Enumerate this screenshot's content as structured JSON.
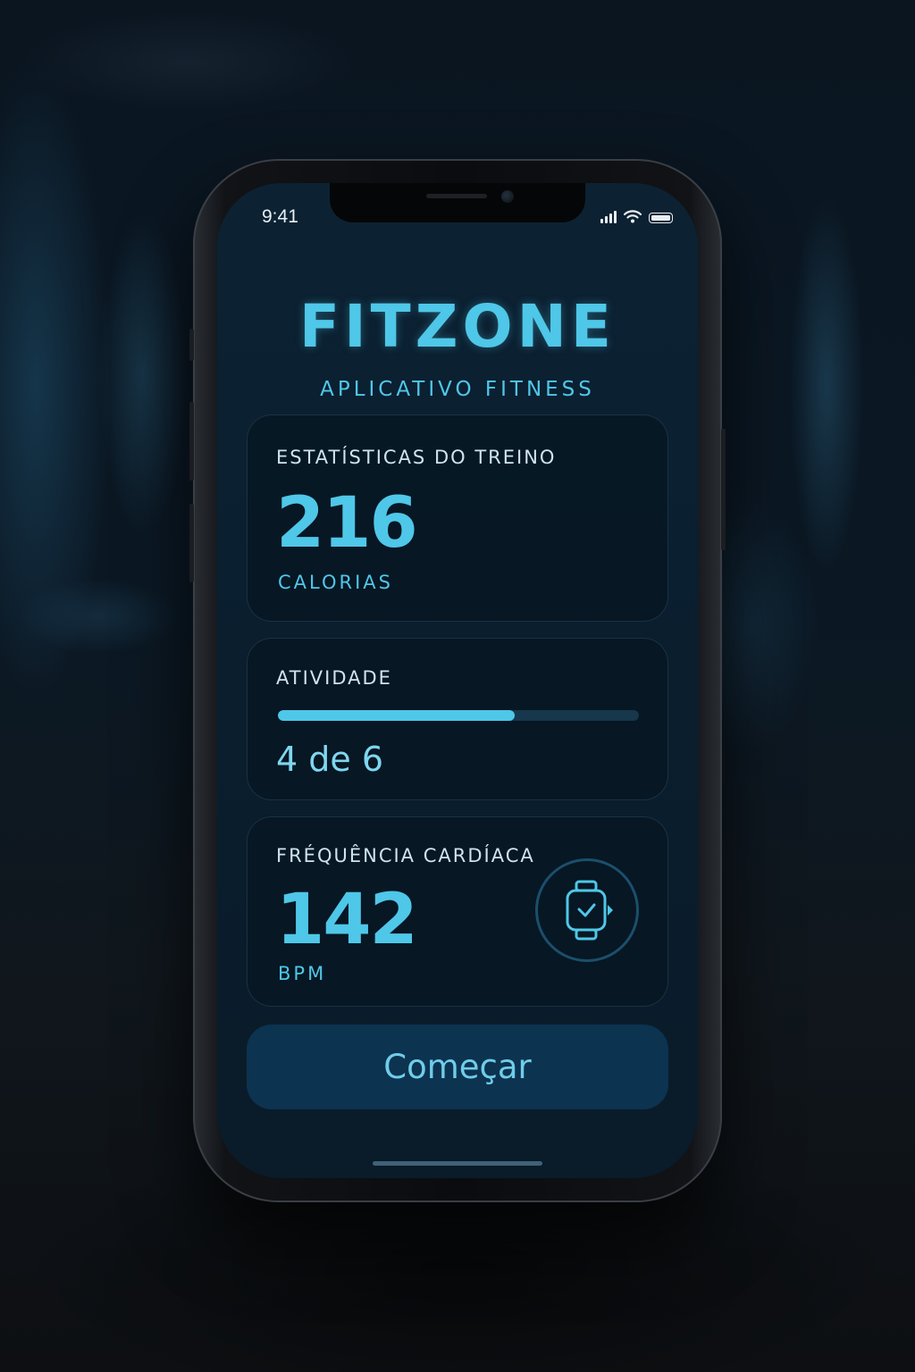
{
  "status_bar": {
    "time": "9:41",
    "icons": [
      "signal-icon",
      "wifi-icon",
      "battery-icon"
    ]
  },
  "app": {
    "brand": "FITZONE",
    "subtitle": "APLICATIVO FITNESS"
  },
  "workout_stats": {
    "label": "ESTATÍSTICAS DO TREINO",
    "value": "216",
    "unit": "CALORIAS"
  },
  "activity": {
    "label": "ATIVIDADE",
    "progress_text": "4 de 6",
    "completed": 4,
    "total": 6,
    "progress_fraction": 0.655
  },
  "heart_rate": {
    "label": "FRÉQUÊNCIA CARDÍACA",
    "value": "142",
    "unit": "BPM",
    "icon": "smartwatch-icon"
  },
  "start_button": {
    "label": "Começar"
  },
  "colors": {
    "accent": "#4fc7e8",
    "background": "#0a1e2e",
    "card": "#071622",
    "button": "#0c3350",
    "progress_track": "#16374c"
  }
}
